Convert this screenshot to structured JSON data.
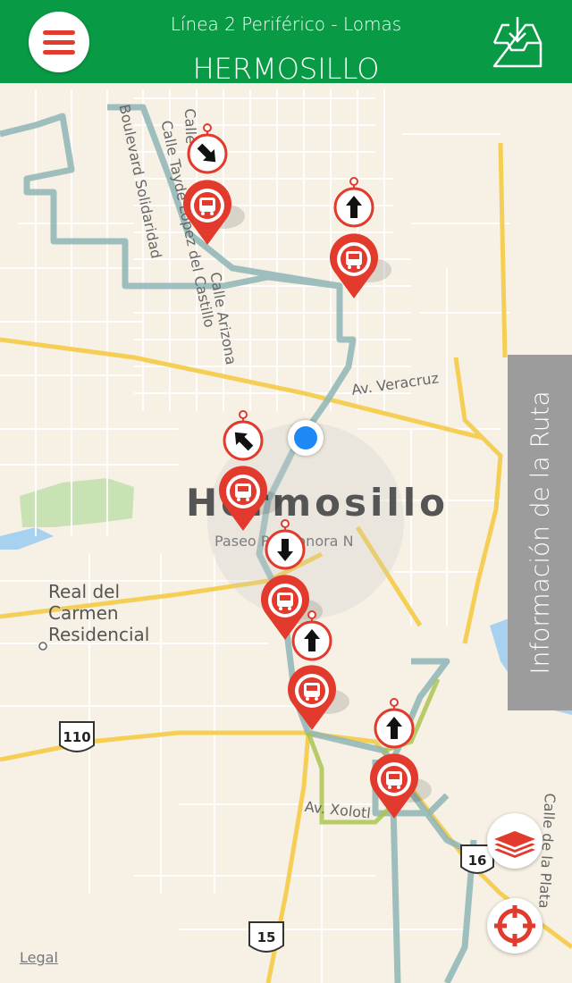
{
  "header": {
    "route_title": "Línea 2 Periférico - Lomas",
    "city": "HERMOSILLO"
  },
  "icons": {
    "menu": "hamburger-menu-icon",
    "download": "download-tray-icon",
    "layers": "layers-icon",
    "locate": "crosshair-icon",
    "stop": "bus-stop-marker-icon"
  },
  "colors": {
    "header": "#099a45",
    "accent": "#e23a2c",
    "route_line": "#8fb6b8",
    "route_highlight": "#a8c34a",
    "user_location": "#1e88f5",
    "info_tab": "#9c9c9c"
  },
  "map": {
    "city_label": "Hermosillo",
    "area_label_line1": "Real del",
    "area_label_line2": "Carmen",
    "area_label_line3": "Residencial",
    "streets": [
      "Boulevard Solidaridad",
      "Calle Tayde López del Castillo",
      "Calle Arizona",
      "Calle",
      "Av. Veracruz",
      "Paseo Río Sonora N",
      "Av. Xolotl",
      "Calle de la Plata"
    ],
    "highway_shields": [
      "110",
      "15",
      "16"
    ],
    "legal": "Legal"
  },
  "info_tab": {
    "label": "Información de la Ruta"
  }
}
